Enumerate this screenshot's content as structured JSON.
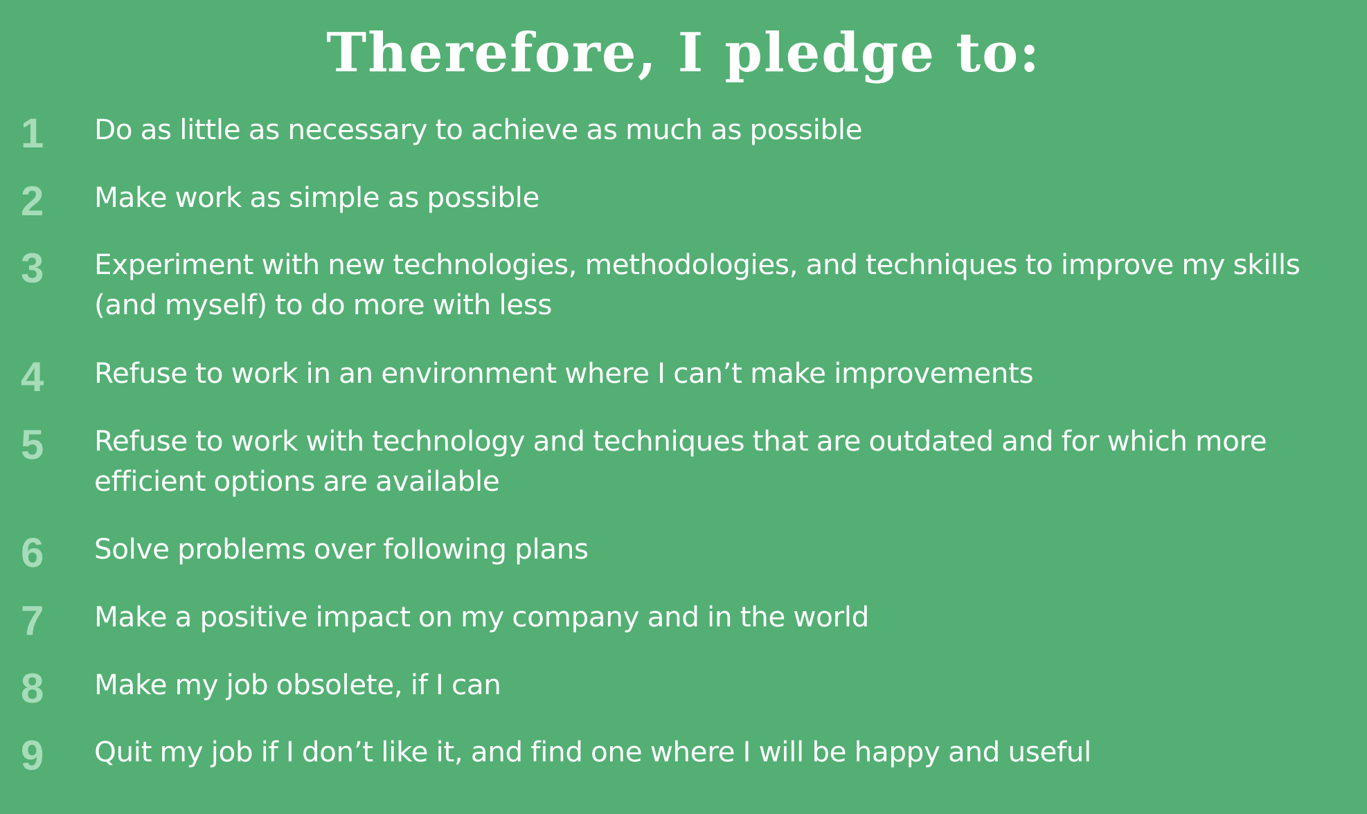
{
  "title": "Therefore, I pledge to:",
  "pledges": [
    {
      "number": "1",
      "text": "Do as little as necessary to achieve as much as possible"
    },
    {
      "number": "2",
      "text": "Make work as simple as possible"
    },
    {
      "number": "3",
      "text": "Experiment with new technologies, methodologies, and techniques to improve my skills (and myself) to do more with less"
    },
    {
      "number": "4",
      "text": "Refuse to work in an environment where I can’t make improvements"
    },
    {
      "number": "5",
      "text": "Refuse to work with technology and techniques that are outdated and for which more efficient options are available"
    },
    {
      "number": "6",
      "text": "Solve problems over following plans"
    },
    {
      "number": "7",
      "text": "Make a positive impact on my company and in the world"
    },
    {
      "number": "8",
      "text": "Make my job obsolete, if I can"
    },
    {
      "number": "9",
      "text": "Quit my job if I don’t like it, and find one where I will be happy and useful"
    }
  ],
  "colors": {
    "background": "#53af73",
    "number": "#a7dcb8",
    "text": "#ffffff"
  }
}
